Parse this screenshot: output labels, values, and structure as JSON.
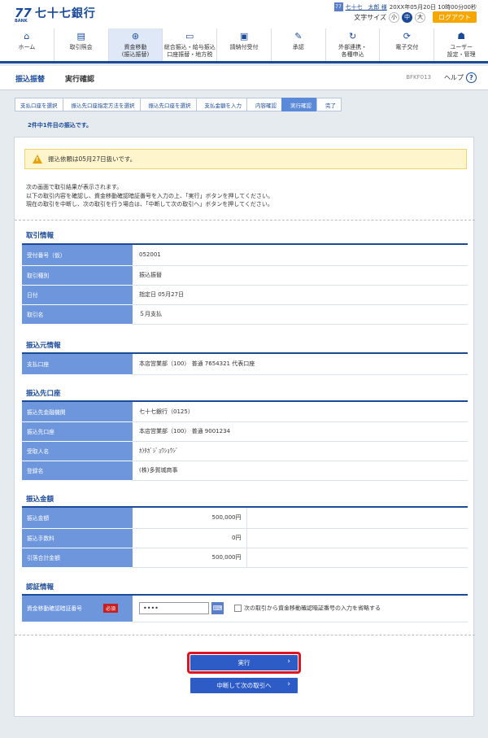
{
  "bank": {
    "logo_mark": "77",
    "logo_sub": "BANK",
    "name": "七十七銀行"
  },
  "user": {
    "badge": "77",
    "name": "七十七　太郎 様",
    "datetime": "20XX年05月20日 10時00分00秒"
  },
  "font_size": {
    "label": "文字サイズ",
    "small": "小",
    "medium": "中",
    "large": "大",
    "selected": "中"
  },
  "logout_label": "ログアウト",
  "nav": [
    {
      "label": "ホーム",
      "icon": "home-icon"
    },
    {
      "label": "取引照会",
      "icon": "document-icon"
    },
    {
      "label": "資金移動\n(振込振替)",
      "icon": "money-transfer-icon",
      "active": true
    },
    {
      "label": "総合振込・給与振込\n口座振替・地方税",
      "icon": "card-icon"
    },
    {
      "label": "請納付受付",
      "icon": "payment-icon"
    },
    {
      "label": "承認",
      "icon": "approval-icon"
    },
    {
      "label": "外部連携・\n各種申込",
      "icon": "link-icon"
    },
    {
      "label": "電子交付",
      "icon": "refresh-icon"
    },
    {
      "label": "ユーザー\n設定・管理",
      "icon": "user-settings-icon"
    }
  ],
  "page": {
    "category": "振込振替",
    "title": "実行確認",
    "code": "BFKF013",
    "help_label": "ヘルプ"
  },
  "steps": [
    "支払口座を選択",
    "振込先口座指定方法を選択",
    "振込先口座を選択",
    "支払金額を入力",
    "内容確認",
    "実行確認",
    "完了"
  ],
  "current_step": "実行確認",
  "progress_note": "2件中1件目の振込です。",
  "warning": "振込依頼は05月27日扱いです。",
  "instructions": [
    "次の画面で取引結果が表示されます。",
    "以下の取引内容を確認し、資金移動確認暗証番号を入力の上、「実行」ボタンを押してください。",
    "現在の取引を中断し、次の取引を行う場合は、「中断して次の取引へ」ボタンを押してください。"
  ],
  "sections": {
    "transaction": {
      "title": "取引情報",
      "rows": [
        {
          "label": "受付番号（仮）",
          "value": "052001"
        },
        {
          "label": "取引種別",
          "value": "振込振替"
        },
        {
          "label": "日付",
          "value": "指定日 05月27日"
        },
        {
          "label": "取引名",
          "value": "５月支払"
        }
      ]
    },
    "source": {
      "title": "振込元情報",
      "rows": [
        {
          "label": "支払口座",
          "value": "本店営業部（100） 普通 7654321 代表口座"
        }
      ]
    },
    "dest": {
      "title": "振込先口座",
      "rows": [
        {
          "label": "振込先金融機関",
          "value": "七十七銀行（0125）"
        },
        {
          "label": "振込先口座",
          "value": "本店営業部（100） 普通 9001234"
        },
        {
          "label": "受取人名",
          "value": "ｶ)ﾀｶﾞｼﾞｮｳｼｮｳｼﾞ"
        },
        {
          "label": "登録名",
          "value": "(株)多賀城商事"
        }
      ]
    },
    "amount": {
      "title": "振込金額",
      "rows": [
        {
          "label": "振込金額",
          "value": "500,000円"
        },
        {
          "label": "振込手数料",
          "value": "0円"
        },
        {
          "label": "引落合計金額",
          "value": "500,000円"
        }
      ]
    },
    "auth": {
      "title": "認証情報",
      "label": "資金移動確認暗証番号",
      "required": "必須",
      "password_value": "••••",
      "checkbox_label": "次の取引から資金移動確認暗証番号の入力を省略する"
    }
  },
  "buttons": {
    "execute": "実行",
    "suspend": "中断して次の取引へ"
  }
}
